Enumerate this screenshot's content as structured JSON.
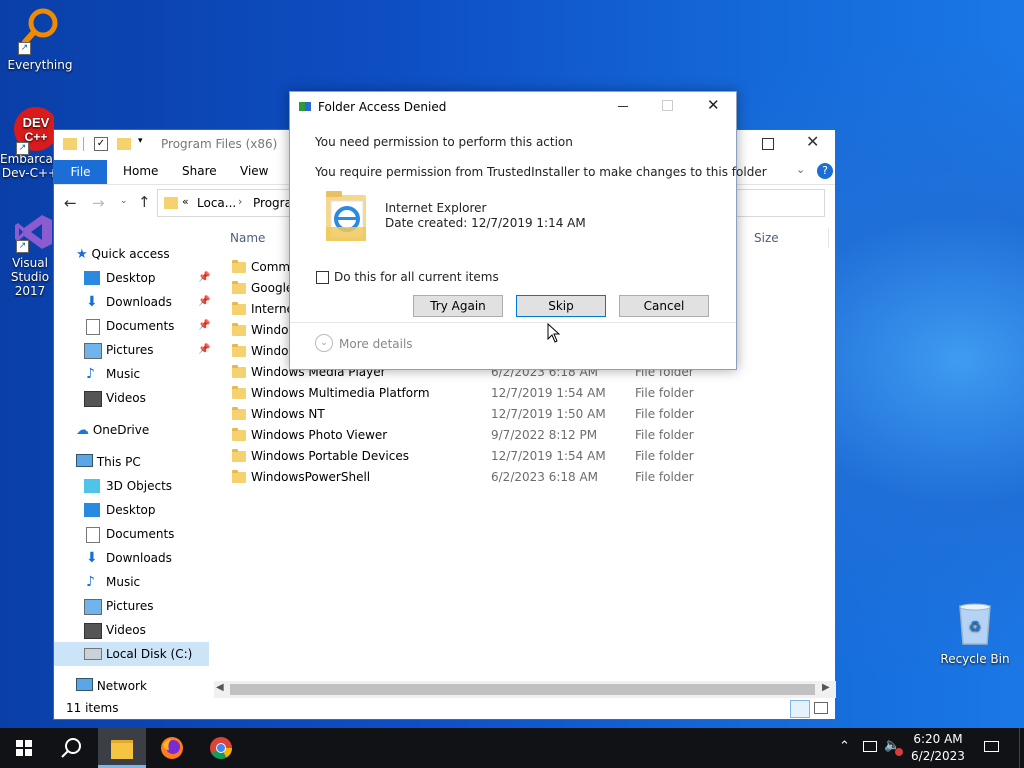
{
  "desktop": {
    "icons": [
      {
        "label": "Everything"
      },
      {
        "label": "Embarcadero Dev-C++"
      },
      {
        "label": "Visual Studio 2017"
      },
      {
        "label": "Recycle Bin"
      }
    ]
  },
  "explorer": {
    "title": "Program Files (x86)",
    "ribbon": {
      "file": "File",
      "home": "Home",
      "share": "Share",
      "view": "View"
    },
    "address": {
      "part1": "Loca...",
      "part2": "Progra"
    },
    "columns": {
      "name": "Name",
      "size": "Size"
    },
    "sidebar": {
      "quick_access": "Quick access",
      "qa_items": [
        "Desktop",
        "Downloads",
        "Documents",
        "Pictures",
        "Music",
        "Videos"
      ],
      "onedrive": "OneDrive",
      "this_pc": "This PC",
      "pc_items": [
        "3D Objects",
        "Desktop",
        "Documents",
        "Downloads",
        "Music",
        "Pictures",
        "Videos",
        "Local Disk (C:)"
      ],
      "network": "Network"
    },
    "rows": [
      {
        "name": "Commo",
        "date": "",
        "type": ""
      },
      {
        "name": "Google",
        "date": "",
        "type": ""
      },
      {
        "name": "Interne",
        "date": "",
        "type": ""
      },
      {
        "name": "Windov",
        "date": "",
        "type": ""
      },
      {
        "name": "Windov",
        "date": "",
        "type": ""
      },
      {
        "name": "Windows Media Player",
        "date": "6/2/2023 6:18 AM",
        "type": "File folder"
      },
      {
        "name": "Windows Multimedia Platform",
        "date": "12/7/2019 1:54 AM",
        "type": "File folder"
      },
      {
        "name": "Windows NT",
        "date": "12/7/2019 1:50 AM",
        "type": "File folder"
      },
      {
        "name": "Windows Photo Viewer",
        "date": "9/7/2022 8:12 PM",
        "type": "File folder"
      },
      {
        "name": "Windows Portable Devices",
        "date": "12/7/2019 1:54 AM",
        "type": "File folder"
      },
      {
        "name": "WindowsPowerShell",
        "date": "6/2/2023 6:18 AM",
        "type": "File folder"
      }
    ],
    "status": "11 items"
  },
  "dialog": {
    "title": "Folder Access Denied",
    "heading": "You need permission to perform this action",
    "message": "You require permission from TrustedInstaller to make changes to this folder",
    "item_name": "Internet Explorer",
    "item_date": "Date created: 12/7/2019 1:14 AM",
    "checkbox_label": "Do this for all current items",
    "buttons": {
      "try_again": "Try Again",
      "skip": "Skip",
      "cancel": "Cancel"
    },
    "more_details": "More details"
  },
  "taskbar": {
    "time": "6:20 AM",
    "date": "6/2/2023"
  },
  "colors": {
    "accent": "#0078d7",
    "folder": "#f5d26e",
    "taskbar": "#101215"
  }
}
